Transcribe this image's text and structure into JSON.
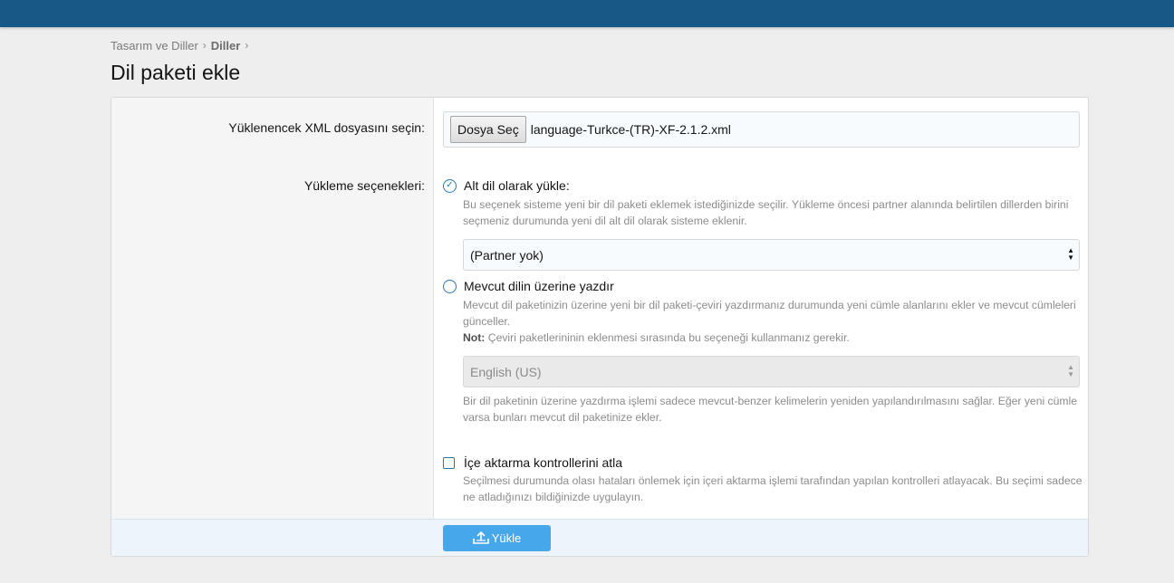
{
  "breadcrumb": {
    "items": [
      "Tasarım ve Diller",
      "Diller"
    ]
  },
  "page": {
    "title": "Dil paketi ekle"
  },
  "form": {
    "file": {
      "label": "Yüklenencek XML dosyasını seçin:",
      "button_label": "Dosya Seç",
      "file_name": "language-Turkce-(TR)-XF-2.1.2.xml"
    },
    "options_label": "Yükleme seçenekleri:",
    "option_child": {
      "label": "Alt dil olarak yükle:",
      "checked": true,
      "hint": "Bu seçenek sisteme yeni bir dil paketi eklemek istediğinizde seçilir. Yükleme öncesi partner alanında belirtilen dillerden birini seçmeniz durumunda yeni dil alt dil olarak sisteme eklenir.",
      "select_value": "(Partner yok)"
    },
    "option_overwrite": {
      "label": "Mevcut dilin üzerine yazdır",
      "checked": false,
      "hint": "Mevcut dil paketinizin üzerine yeni bir dil paketi-çeviri yazdırmanız durumunda yeni cümle alanlarını ekler ve mevcut cümleleri günceller.",
      "note_label": "Not:",
      "note_text": " Çeviri paketlerininin eklenmesi sırasında bu seçeneği kullanmanız gerekir.",
      "select_value": "English (US)",
      "hint_after": "Bir dil paketinin üzerine yazdırma işlemi sadece mevcut-benzer kelimelerin yeniden yapılandırılmasını sağlar. Eğer yeni cümle varsa bunları mevcut dil paketinize ekler."
    },
    "option_skip_checks": {
      "label": "İçe aktarma kontrollerini atla",
      "checked": false,
      "hint": "Seçilmesi durumunda olası hataları önlemek için içeri aktarma işlemi tarafından yapılan kontrolleri atlayacak. Bu seçimi sadece ne atladığınızı bildiğinizde uygulayın."
    },
    "submit_label": "Yükle"
  },
  "colors": {
    "topbar": "#185886",
    "accent": "#2577b1",
    "button": "#47a7eb"
  }
}
